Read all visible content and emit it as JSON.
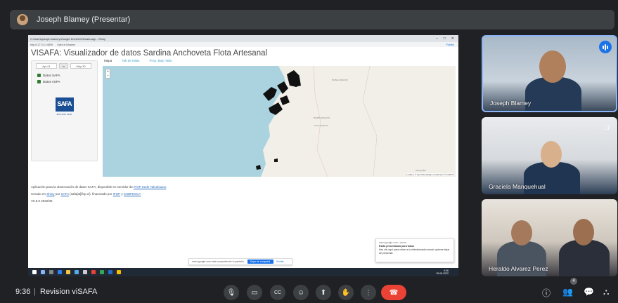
{
  "presenter": {
    "name": "Joseph Blamey (Presentar)"
  },
  "shared_screen": {
    "browser": {
      "tab_path": "C:/Users/joseph.blamey/Google Drive/2022/safa.app - Shiny",
      "url": "http://127.0.0.1:6699",
      "open_in_browser": "Open in Browser",
      "window_controls": [
        "–",
        "□",
        "✕"
      ],
      "publish": "Publish"
    },
    "app_title": "VISAFA: Visualizador de datos Sardina Anchoveta Flota Artesanal",
    "date_range": {
      "start": "Apr 01",
      "to": "to",
      "end": "May 30"
    },
    "checkboxes": [
      {
        "label": "Datos SAFA",
        "checked": true
      },
      {
        "label": "Datos ASPA",
        "checked": true
      }
    ],
    "logo": {
      "text": "SAFA",
      "subtitle": "ESTUDIO SAFA"
    },
    "tabs": [
      "Mapa",
      "Tab de tallas",
      "Prop. Bajo Talla"
    ],
    "map": {
      "zoom_in": "+",
      "zoom_out": "−",
      "labels": [
        "ÑUBLE REGION",
        "BIOBIO REGION",
        "LOS ANGELES",
        "NEUQUÉN"
      ],
      "credit": "Leaflet | © OpenStreetMap contributors © CARTO"
    },
    "footer": {
      "line1_prefix": "Aplicación para la observación de datos SAFA, disponible en servidor de",
      "line1_link": "IFOP Sede Talcahuano",
      "line2_prefix": "Creado en",
      "line2_link1": "Shiny",
      "line2_mid1": "por",
      "line2_link2": "SAFA",
      "line2_mid2": "(safa[at]ifop.cl). financiado por",
      "line2_link3": "IFOP",
      "line2_mid3": "y",
      "line2_link4": "SUBPESCA",
      "version": "V0.5.0 2022/06"
    },
    "share_notice": {
      "text": "meet.google.com está compartiendo tu pantalla.",
      "stop": "Dejar de compartir",
      "hide": "Ocultar"
    },
    "popup": {
      "source": "meet.google.com • ahora",
      "title": "Estás presentando para todos",
      "body": "Haz clic aquí para volver a la videollamada cuando quieras dejar de presentar."
    },
    "taskbar": {
      "time": "9:36",
      "date": "15-06-2022"
    }
  },
  "participants": [
    {
      "name": "Joseph Blamey",
      "speaking": true
    },
    {
      "name": "Graciela Manquehual",
      "muted": true
    },
    {
      "name": "Heraldo Alvarez Perez"
    }
  ],
  "bottom_bar": {
    "time": "9:36",
    "separator": "|",
    "meeting_name": "Revision viSAFA",
    "participant_count": "4",
    "icons": {
      "mic": "🎙",
      "camera": "▭",
      "captions": "CC",
      "emoji": "☺",
      "present": "⬆",
      "hand": "✋",
      "more": "⋮",
      "end_call": "☎",
      "info": "ⓘ",
      "people": "👥",
      "chat": "💬",
      "activities": "⛬"
    }
  }
}
